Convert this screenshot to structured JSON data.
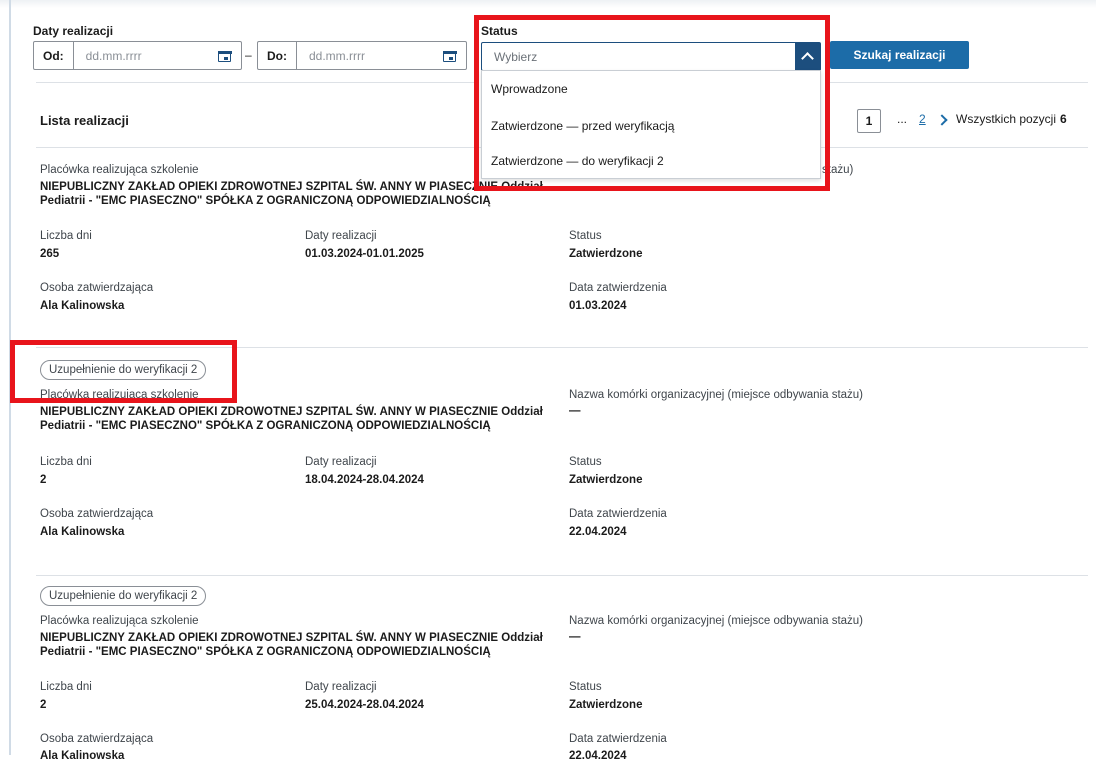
{
  "filters": {
    "dates_label": "Daty realizacji",
    "from_prefix": "Od:",
    "to_prefix": "Do:",
    "date_placeholder": "dd.mm.rrrr",
    "separator": "–",
    "status_label": "Status",
    "status_placeholder": "Wybierz",
    "search_button": "Szukaj realizacji",
    "status_options": [
      "Wprowadzone",
      "Zatwierdzone — przed weryfikacją",
      "Zatwierdzone — do weryfikacji 2"
    ]
  },
  "list": {
    "title": "Lista realizacji",
    "pagination": {
      "current_page": "1",
      "ellipsis": "...",
      "next_page": "2",
      "total_label": "Wszystkich pozycji",
      "total_count": "6"
    }
  },
  "labels": {
    "facility": "Placówka realizująca szkolenie",
    "unit": "Nazwa komórki organizacyjnej (miejsce odbywania stażu)",
    "unit_partial": "stażu)",
    "days": "Liczba dni",
    "dates": "Daty realizacji",
    "status": "Status",
    "approver": "Osoba zatwierdzająca",
    "approval_date": "Data zatwierdzenia"
  },
  "records": [
    {
      "badge": "",
      "facility_line1": "NIEPUBLICZNY ZAKŁAD OPIEKI ZDROWOTNEJ SZPITAL ŚW. ANNY W PIASECZNIE Oddział",
      "facility_line2": "Pediatrii - \"EMC PIASECZNO\" SPÓŁKA Z OGRANICZONĄ ODPOWIEDZIALNOŚCIĄ",
      "unit": "",
      "days": "265",
      "dates": "01.03.2024-01.01.2025",
      "status": "Zatwierdzone",
      "approver": "Ala Kalinowska",
      "approval_date": "01.03.2024"
    },
    {
      "badge": "Uzupełnienie do weryfikacji 2",
      "facility_line1": "NIEPUBLICZNY ZAKŁAD OPIEKI ZDROWOTNEJ SZPITAL ŚW. ANNY W PIASECZNIE Oddział",
      "facility_line2": "Pediatrii - \"EMC PIASECZNO\" SPÓŁKA Z OGRANICZONĄ ODPOWIEDZIALNOŚCIĄ",
      "unit": "—",
      "days": "2",
      "dates": "18.04.2024-28.04.2024",
      "status": "Zatwierdzone",
      "approver": "Ala Kalinowska",
      "approval_date": "22.04.2024"
    },
    {
      "badge": "Uzupełnienie do weryfikacji 2",
      "facility_line1": "NIEPUBLICZNY ZAKŁAD OPIEKI ZDROWOTNEJ SZPITAL ŚW. ANNY W PIASECZNIE Oddział",
      "facility_line2": "Pediatrii - \"EMC PIASECZNO\" SPÓŁKA Z OGRANICZONĄ ODPOWIEDZIALNOŚCIĄ",
      "unit": "—",
      "days": "2",
      "dates": "25.04.2024-28.04.2024",
      "status": "Zatwierdzone",
      "approver": "Ala Kalinowska",
      "approval_date": "22.04.2024"
    }
  ],
  "colors": {
    "primary": "#1c6ca8",
    "dark_primary": "#1c4e7e",
    "highlight": "#e8141b"
  }
}
